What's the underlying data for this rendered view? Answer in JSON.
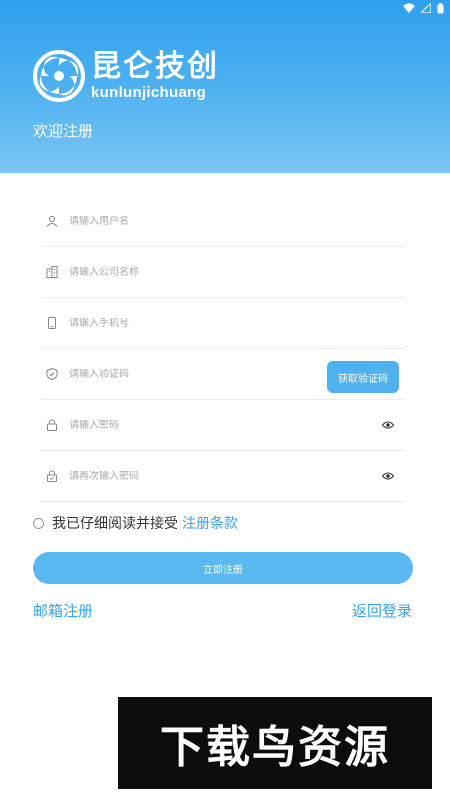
{
  "header": {
    "brand_cn": "昆仑技创",
    "brand_en": "kunlunjichuang",
    "welcome": "欢迎注册"
  },
  "form": {
    "username": {
      "placeholder": "请输入用户名",
      "icon": "user-icon"
    },
    "company": {
      "placeholder": "请输入公司名称",
      "icon": "building-icon"
    },
    "phone": {
      "placeholder": "请输入手机号",
      "icon": "phone-icon"
    },
    "code": {
      "placeholder": "请输入验证码",
      "icon": "shield-icon",
      "button": "获取验证码"
    },
    "password": {
      "placeholder": "请输入密码",
      "icon": "lock-icon"
    },
    "confirm": {
      "placeholder": "请再次输入密码",
      "icon": "lock-check-icon"
    }
  },
  "agreement": {
    "checked": false,
    "text": "我已仔细阅读并接受",
    "link": "注册条款"
  },
  "actions": {
    "submit": "立即注册",
    "email_register": "邮箱注册",
    "back_login": "返回登录"
  },
  "watermark": "下载鸟资源",
  "colors": {
    "primary": "#4fb1ee",
    "link": "#3aa3ea",
    "header_top": "#2ea0ee"
  }
}
